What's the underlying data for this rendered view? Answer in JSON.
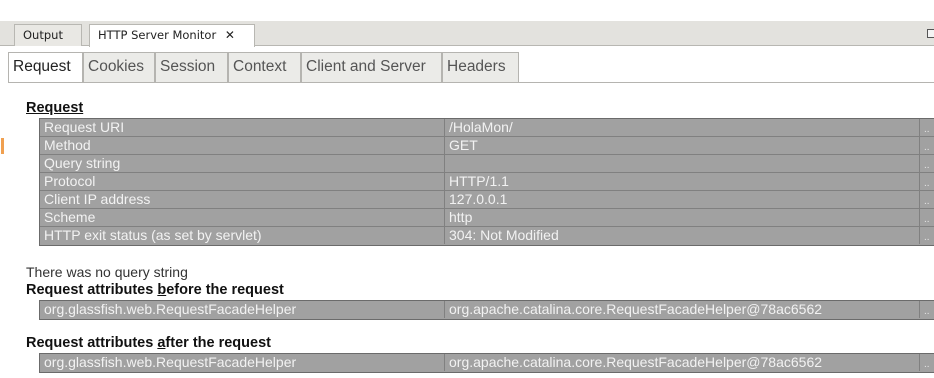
{
  "editor_tabs": [
    {
      "label": "Output",
      "active": false
    },
    {
      "label": "HTTP Server Monitor",
      "active": true,
      "close_glyph": "✕"
    }
  ],
  "content_tabs": [
    {
      "label": "Request",
      "active": true
    },
    {
      "label": "Cookies",
      "active": false
    },
    {
      "label": "Session",
      "active": false
    },
    {
      "label": "Context",
      "active": false
    },
    {
      "label": "Client and Server",
      "active": false
    },
    {
      "label": "Headers",
      "active": false
    }
  ],
  "request_section": {
    "title": "Request",
    "rows": [
      {
        "key": "Request URI",
        "value": "/HolaMon/"
      },
      {
        "key": "Method",
        "value": "GET"
      },
      {
        "key": "Query string",
        "value": ""
      },
      {
        "key": "Protocol",
        "value": "HTTP/1.1"
      },
      {
        "key": "Client IP address",
        "value": "127.0.0.1"
      },
      {
        "key": "Scheme",
        "value": "http"
      },
      {
        "key": "HTTP exit status (as set by servlet)",
        "value": "304: Not Modified"
      }
    ],
    "dots": ".."
  },
  "query_note": "There was no query string",
  "attrs_before": {
    "title_pre": "Request attributes ",
    "title_u": "b",
    "title_post": "efore the request",
    "rows": [
      {
        "key": "org.glassfish.web.RequestFacadeHelper",
        "value": "org.apache.catalina.core.RequestFacadeHelper@78ac6562"
      }
    ],
    "dots": ".."
  },
  "attrs_after": {
    "title_pre": "Request attributes ",
    "title_u": "a",
    "title_post": "fter the request",
    "rows": [
      {
        "key": "org.glassfish.web.RequestFacadeHelper",
        "value": "org.apache.catalina.core.RequestFacadeHelper@78ac6562"
      }
    ],
    "dots": ".."
  }
}
